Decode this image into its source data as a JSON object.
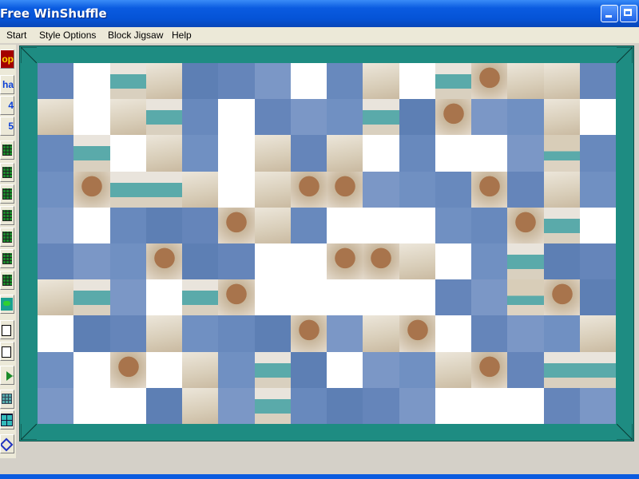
{
  "window": {
    "title": "Free WinShuffle"
  },
  "menu": {
    "items": [
      "Start",
      "Style Options",
      "Block Jigsaw",
      "Help"
    ]
  },
  "toolbar": {
    "labels": {
      "stop": "op",
      "shape": "ha",
      "four": "4",
      "five": "5"
    }
  },
  "colors": {
    "frame": "#1e8c82",
    "blue_tile": "#6a8bbd",
    "white_tile": "#ffffff",
    "sand_tile": "#d8cdb8",
    "sea_tile": "#5aaaaa",
    "skin_tile": "#a8744c"
  },
  "puzzle": {
    "cols": 16,
    "rows": 10,
    "legend": "B=blue blank, W=white blank, S=sand, A=sea, K=skin/figure, E=sand+sea",
    "grid": [
      "BWASBBBWBSWAKSSB",
      "SWSABWBBBABKBBSW",
      "BAWSBWSBSWBWWBEB",
      "BKAASWSKKBBBKBSB",
      "BWBBBKSBWWWBBKAW",
      "BBBKBBWWKKSWBABB",
      "SABWAKWWWWWBBEKB",
      "WBBSBBBKBSKWBBBS",
      "BWKWSBABWBBSKBAA",
      "BWWBSBABBBBWWWBB"
    ]
  }
}
